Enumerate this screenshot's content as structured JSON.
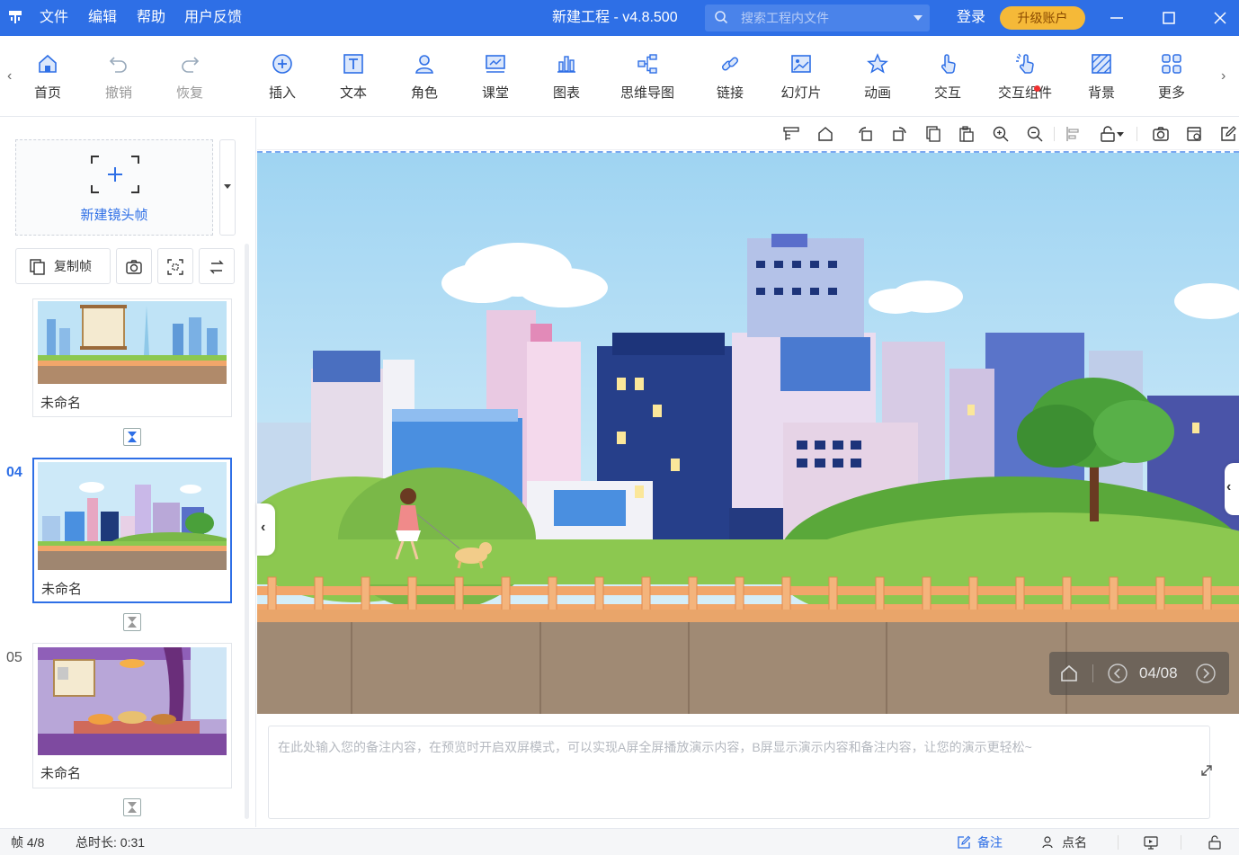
{
  "titlebar": {
    "menus": [
      "文件",
      "编辑",
      "帮助",
      "用户反馈"
    ],
    "title": "新建工程 - v4.8.500",
    "search_placeholder": "搜索工程内文件",
    "login": "登录",
    "upgrade": "升级账户"
  },
  "toolbar": {
    "items": [
      {
        "label": "首页",
        "icon": "home-icon",
        "disabled": false
      },
      {
        "label": "撤销",
        "icon": "undo-icon",
        "disabled": true
      },
      {
        "label": "恢复",
        "icon": "redo-icon",
        "disabled": true
      },
      {
        "label": "插入",
        "icon": "plus-circle-icon",
        "disabled": false
      },
      {
        "label": "文本",
        "icon": "text-icon",
        "disabled": false
      },
      {
        "label": "角色",
        "icon": "character-icon",
        "disabled": false
      },
      {
        "label": "课堂",
        "icon": "classroom-icon",
        "disabled": false
      },
      {
        "label": "图表",
        "icon": "chart-icon",
        "disabled": false
      },
      {
        "label": "思维导图",
        "icon": "mindmap-icon",
        "disabled": false
      },
      {
        "label": "链接",
        "icon": "link-icon",
        "disabled": false
      },
      {
        "label": "幻灯片",
        "icon": "slide-icon",
        "disabled": false
      },
      {
        "label": "动画",
        "icon": "star-icon",
        "disabled": false
      },
      {
        "label": "交互",
        "icon": "hand-icon",
        "disabled": false
      },
      {
        "label": "交互组件",
        "icon": "interactive-component-icon",
        "disabled": false
      },
      {
        "label": "背景",
        "icon": "background-icon",
        "disabled": false
      },
      {
        "label": "更多",
        "icon": "grid-icon",
        "disabled": false
      }
    ]
  },
  "leftpanel": {
    "new_frame_label": "新建镜头帧",
    "copy_frame_label": "复制帧",
    "frames": [
      {
        "number": "",
        "name": "未命名",
        "active": false
      },
      {
        "number": "04",
        "name": "未命名",
        "active": true
      },
      {
        "number": "05",
        "name": "未命名",
        "active": false
      }
    ]
  },
  "canvas": {
    "pager": "04/08"
  },
  "notes": {
    "placeholder": "在此处输入您的备注内容，在预览时开启双屏模式，可以实现A屏全屏播放演示内容，B屏显示演示内容和备注内容，让您的演示更轻松~"
  },
  "statusbar": {
    "frame": "帧 4/8",
    "duration": "总时长: 0:31",
    "notes": "备注",
    "rollcall": "点名"
  },
  "colors": {
    "accent": "#2e6fe6",
    "upgrade": "#f5b938"
  }
}
